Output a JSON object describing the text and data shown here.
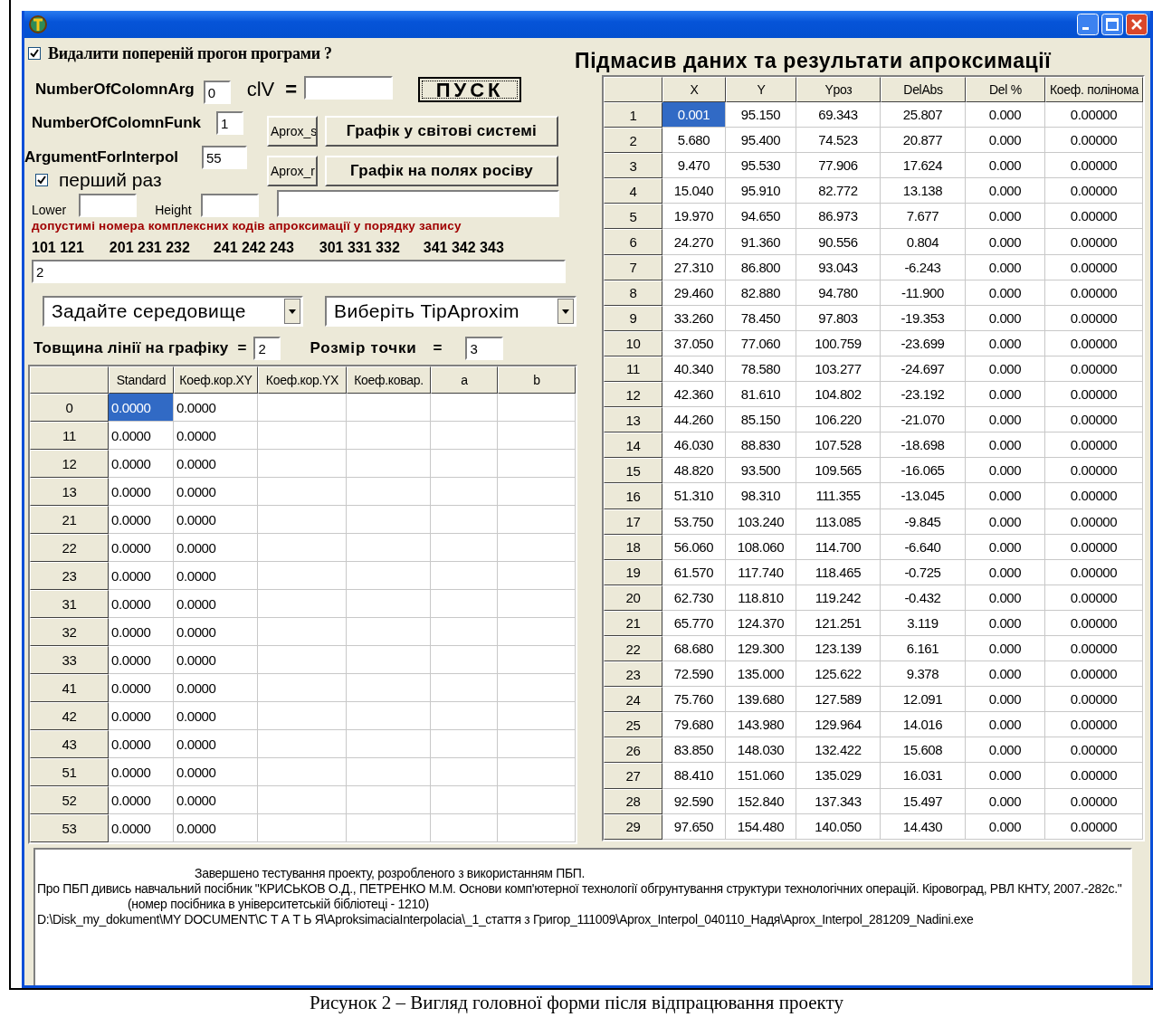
{
  "options": {
    "delete_previous": {
      "label": "Видалити  попереній прогон програми  ?",
      "checked": true
    },
    "column_arg": {
      "label": "NumberOfColomnArg",
      "value": "0"
    },
    "clv": {
      "label": "clV",
      "equals": "="
    },
    "start_button": "ПУСК",
    "column_funk": {
      "label": "NumberOfColomnFunk",
      "value": "1"
    },
    "interpol": {
      "label": "ArgumentForInterpol",
      "value": "55"
    },
    "first_time": {
      "label": "перший раз",
      "checked": true
    },
    "buttons": [
      {
        "small": "Aprox_s",
        "large": "Графік у світові системі"
      },
      {
        "small": "Aprox_r",
        "large": "Графік на полях росіву"
      }
    ],
    "lower": {
      "label": "Lower"
    },
    "height": {
      "label": "Height"
    },
    "allowed_note": "допустимі номера  комплексних кодів апроксимації у  порядку  запису",
    "codes": [
      "101 121",
      "201 231 232",
      "241 242 243",
      "301 331 332",
      "341 342 343"
    ],
    "code_input": {
      "value": "2"
    },
    "dropdowns": [
      "Задайте  середовище",
      "Виберіть TipAproxim"
    ],
    "line_width": {
      "label": "Товщина лінії  на графіку",
      "equals": "=",
      "value": "2"
    },
    "point_size": {
      "label": "Розмір  точки",
      "equals": "=",
      "value": "3"
    }
  },
  "stats_table": {
    "columns": [
      "Standard",
      "Коеф.кор.XY",
      "Коеф.кор.YX",
      "Коеф.ковар.",
      "a",
      "b"
    ],
    "rows": [
      {
        "label": "0",
        "cells": [
          "0.0000",
          "0.0000"
        ],
        "selected": true
      },
      {
        "label": "11",
        "cells": [
          "0.0000",
          "0.0000"
        ],
        "selected": false
      },
      {
        "label": "12",
        "cells": [
          "0.0000",
          "0.0000"
        ],
        "selected": false
      },
      {
        "label": "13",
        "cells": [
          "0.0000",
          "0.0000"
        ],
        "selected": false
      },
      {
        "label": "21",
        "cells": [
          "0.0000",
          "0.0000"
        ],
        "selected": false
      },
      {
        "label": "22",
        "cells": [
          "0.0000",
          "0.0000"
        ],
        "selected": false
      },
      {
        "label": "23",
        "cells": [
          "0.0000",
          "0.0000"
        ],
        "selected": false
      },
      {
        "label": "31",
        "cells": [
          "0.0000",
          "0.0000"
        ],
        "selected": false
      },
      {
        "label": "32",
        "cells": [
          "0.0000",
          "0.0000"
        ],
        "selected": false
      },
      {
        "label": "33",
        "cells": [
          "0.0000",
          "0.0000"
        ],
        "selected": false
      },
      {
        "label": "41",
        "cells": [
          "0.0000",
          "0.0000"
        ],
        "selected": false
      },
      {
        "label": "42",
        "cells": [
          "0.0000",
          "0.0000"
        ],
        "selected": false
      },
      {
        "label": "43",
        "cells": [
          "0.0000",
          "0.0000"
        ],
        "selected": false
      },
      {
        "label": "51",
        "cells": [
          "0.0000",
          "0.0000"
        ],
        "selected": false
      },
      {
        "label": "52",
        "cells": [
          "0.0000",
          "0.0000"
        ],
        "selected": false
      },
      {
        "label": "53",
        "cells": [
          "0.0000",
          "0.0000"
        ],
        "selected": false
      }
    ]
  },
  "results": {
    "title": "Підмасив  даних та результати  апроксимації",
    "columns": [
      "X",
      "Y",
      "Yроз",
      "DelAbs",
      "Del %",
      "Коеф. полінома"
    ],
    "rows": [
      {
        "label": "1",
        "cells": [
          "0.001",
          "95.150",
          "69.343",
          "25.807",
          "0.000",
          "0.00000"
        ],
        "selected": true
      },
      {
        "label": "2",
        "cells": [
          "5.680",
          "95.400",
          "74.523",
          "20.877",
          "0.000",
          "0.00000"
        ],
        "selected": false
      },
      {
        "label": "3",
        "cells": [
          "9.470",
          "95.530",
          "77.906",
          "17.624",
          "0.000",
          "0.00000"
        ],
        "selected": false
      },
      {
        "label": "4",
        "cells": [
          "15.040",
          "95.910",
          "82.772",
          "13.138",
          "0.000",
          "0.00000"
        ],
        "selected": false
      },
      {
        "label": "5",
        "cells": [
          "19.970",
          "94.650",
          "86.973",
          "7.677",
          "0.000",
          "0.00000"
        ],
        "selected": false
      },
      {
        "label": "6",
        "cells": [
          "24.270",
          "91.360",
          "90.556",
          "0.804",
          "0.000",
          "0.00000"
        ],
        "selected": false
      },
      {
        "label": "7",
        "cells": [
          "27.310",
          "86.800",
          "93.043",
          "-6.243",
          "0.000",
          "0.00000"
        ],
        "selected": false
      },
      {
        "label": "8",
        "cells": [
          "29.460",
          "82.880",
          "94.780",
          "-11.900",
          "0.000",
          "0.00000"
        ],
        "selected": false
      },
      {
        "label": "9",
        "cells": [
          "33.260",
          "78.450",
          "97.803",
          "-19.353",
          "0.000",
          "0.00000"
        ],
        "selected": false
      },
      {
        "label": "10",
        "cells": [
          "37.050",
          "77.060",
          "100.759",
          "-23.699",
          "0.000",
          "0.00000"
        ],
        "selected": false
      },
      {
        "label": "11",
        "cells": [
          "40.340",
          "78.580",
          "103.277",
          "-24.697",
          "0.000",
          "0.00000"
        ],
        "selected": false
      },
      {
        "label": "12",
        "cells": [
          "42.360",
          "81.610",
          "104.802",
          "-23.192",
          "0.000",
          "0.00000"
        ],
        "selected": false
      },
      {
        "label": "13",
        "cells": [
          "44.260",
          "85.150",
          "106.220",
          "-21.070",
          "0.000",
          "0.00000"
        ],
        "selected": false
      },
      {
        "label": "14",
        "cells": [
          "46.030",
          "88.830",
          "107.528",
          "-18.698",
          "0.000",
          "0.00000"
        ],
        "selected": false
      },
      {
        "label": "15",
        "cells": [
          "48.820",
          "93.500",
          "109.565",
          "-16.065",
          "0.000",
          "0.00000"
        ],
        "selected": false
      },
      {
        "label": "16",
        "cells": [
          "51.310",
          "98.310",
          "111.355",
          "-13.045",
          "0.000",
          "0.00000"
        ],
        "selected": false
      },
      {
        "label": "17",
        "cells": [
          "53.750",
          "103.240",
          "113.085",
          "-9.845",
          "0.000",
          "0.00000"
        ],
        "selected": false
      },
      {
        "label": "18",
        "cells": [
          "56.060",
          "108.060",
          "114.700",
          "-6.640",
          "0.000",
          "0.00000"
        ],
        "selected": false
      },
      {
        "label": "19",
        "cells": [
          "61.570",
          "117.740",
          "118.465",
          "-0.725",
          "0.000",
          "0.00000"
        ],
        "selected": false
      },
      {
        "label": "20",
        "cells": [
          "62.730",
          "118.810",
          "119.242",
          "-0.432",
          "0.000",
          "0.00000"
        ],
        "selected": false
      },
      {
        "label": "21",
        "cells": [
          "65.770",
          "124.370",
          "121.251",
          "3.119",
          "0.000",
          "0.00000"
        ],
        "selected": false
      },
      {
        "label": "22",
        "cells": [
          "68.680",
          "129.300",
          "123.139",
          "6.161",
          "0.000",
          "0.00000"
        ],
        "selected": false
      },
      {
        "label": "23",
        "cells": [
          "72.590",
          "135.000",
          "125.622",
          "9.378",
          "0.000",
          "0.00000"
        ],
        "selected": false
      },
      {
        "label": "24",
        "cells": [
          "75.760",
          "139.680",
          "127.589",
          "12.091",
          "0.000",
          "0.00000"
        ],
        "selected": false
      },
      {
        "label": "25",
        "cells": [
          "79.680",
          "143.980",
          "129.964",
          "14.016",
          "0.000",
          "0.00000"
        ],
        "selected": false
      },
      {
        "label": "26",
        "cells": [
          "83.850",
          "148.030",
          "132.422",
          "15.608",
          "0.000",
          "0.00000"
        ],
        "selected": false
      },
      {
        "label": "27",
        "cells": [
          "88.410",
          "151.060",
          "135.029",
          "16.031",
          "0.000",
          "0.00000"
        ],
        "selected": false
      },
      {
        "label": "28",
        "cells": [
          "92.590",
          "152.840",
          "137.343",
          "15.497",
          "0.000",
          "0.00000"
        ],
        "selected": false
      },
      {
        "label": "29",
        "cells": [
          "97.650",
          "154.480",
          "140.050",
          "14.430",
          "0.000",
          "0.00000"
        ],
        "selected": false
      }
    ]
  },
  "memo": [
    "Завершено тестування проекту, розробленого з використанням ПБП.",
    "Про  ПБП  дивись навчальний посібник  \"КРИСЬКОВ О.Д., ПЕТРЕНКО М.М.  Основи комп'ютерної технології  обгрунтування структури технологічних операцій.  Кіровоград, РВЛ КНТУ,  2007.-282с.\"",
    "(номер посібника в університетській бібліотеці - 1210)",
    "D:\\Disk_my_dokument\\MY DOCUMENT\\С Т А Т Ь Я\\AproksimaciaInterpolacia\\_1_стаття з Григор_111009\\Aprox_Interpol_040110_Надя\\Aprox_Interpol_281209_Nadini.exe"
  ],
  "caption": "Рисунок 2  –  Вигляд головної форми після відпрацювання проекту"
}
